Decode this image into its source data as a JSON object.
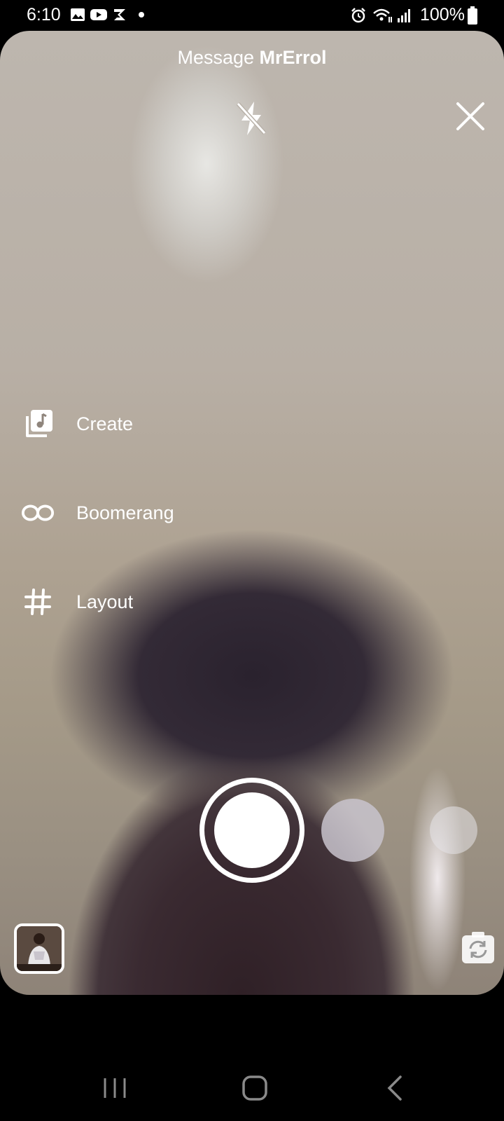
{
  "status_bar": {
    "time": "6:10",
    "battery": "100%",
    "icons": [
      "gallery-icon",
      "youtube-icon",
      "s-app-icon",
      "dot-icon",
      "alarm-icon",
      "wifi-icon",
      "signal-icon",
      "battery-icon"
    ]
  },
  "header": {
    "prefix": "Message ",
    "recipient": "MrErrol"
  },
  "side_menu": {
    "items": [
      {
        "label": "Create",
        "icon": "create-icon"
      },
      {
        "label": "Boomerang",
        "icon": "infinity-icon"
      },
      {
        "label": "Layout",
        "icon": "grid-icon"
      }
    ]
  },
  "camera": {
    "flash_icon": "flash-off-icon",
    "close_icon": "close-icon",
    "flip_icon": "flip-camera-icon"
  },
  "nav_bar": {
    "icons": [
      "recent-apps-icon",
      "home-icon",
      "back-icon"
    ]
  },
  "colors": {
    "overlay_text": "#ffffff",
    "background": "#000000"
  }
}
